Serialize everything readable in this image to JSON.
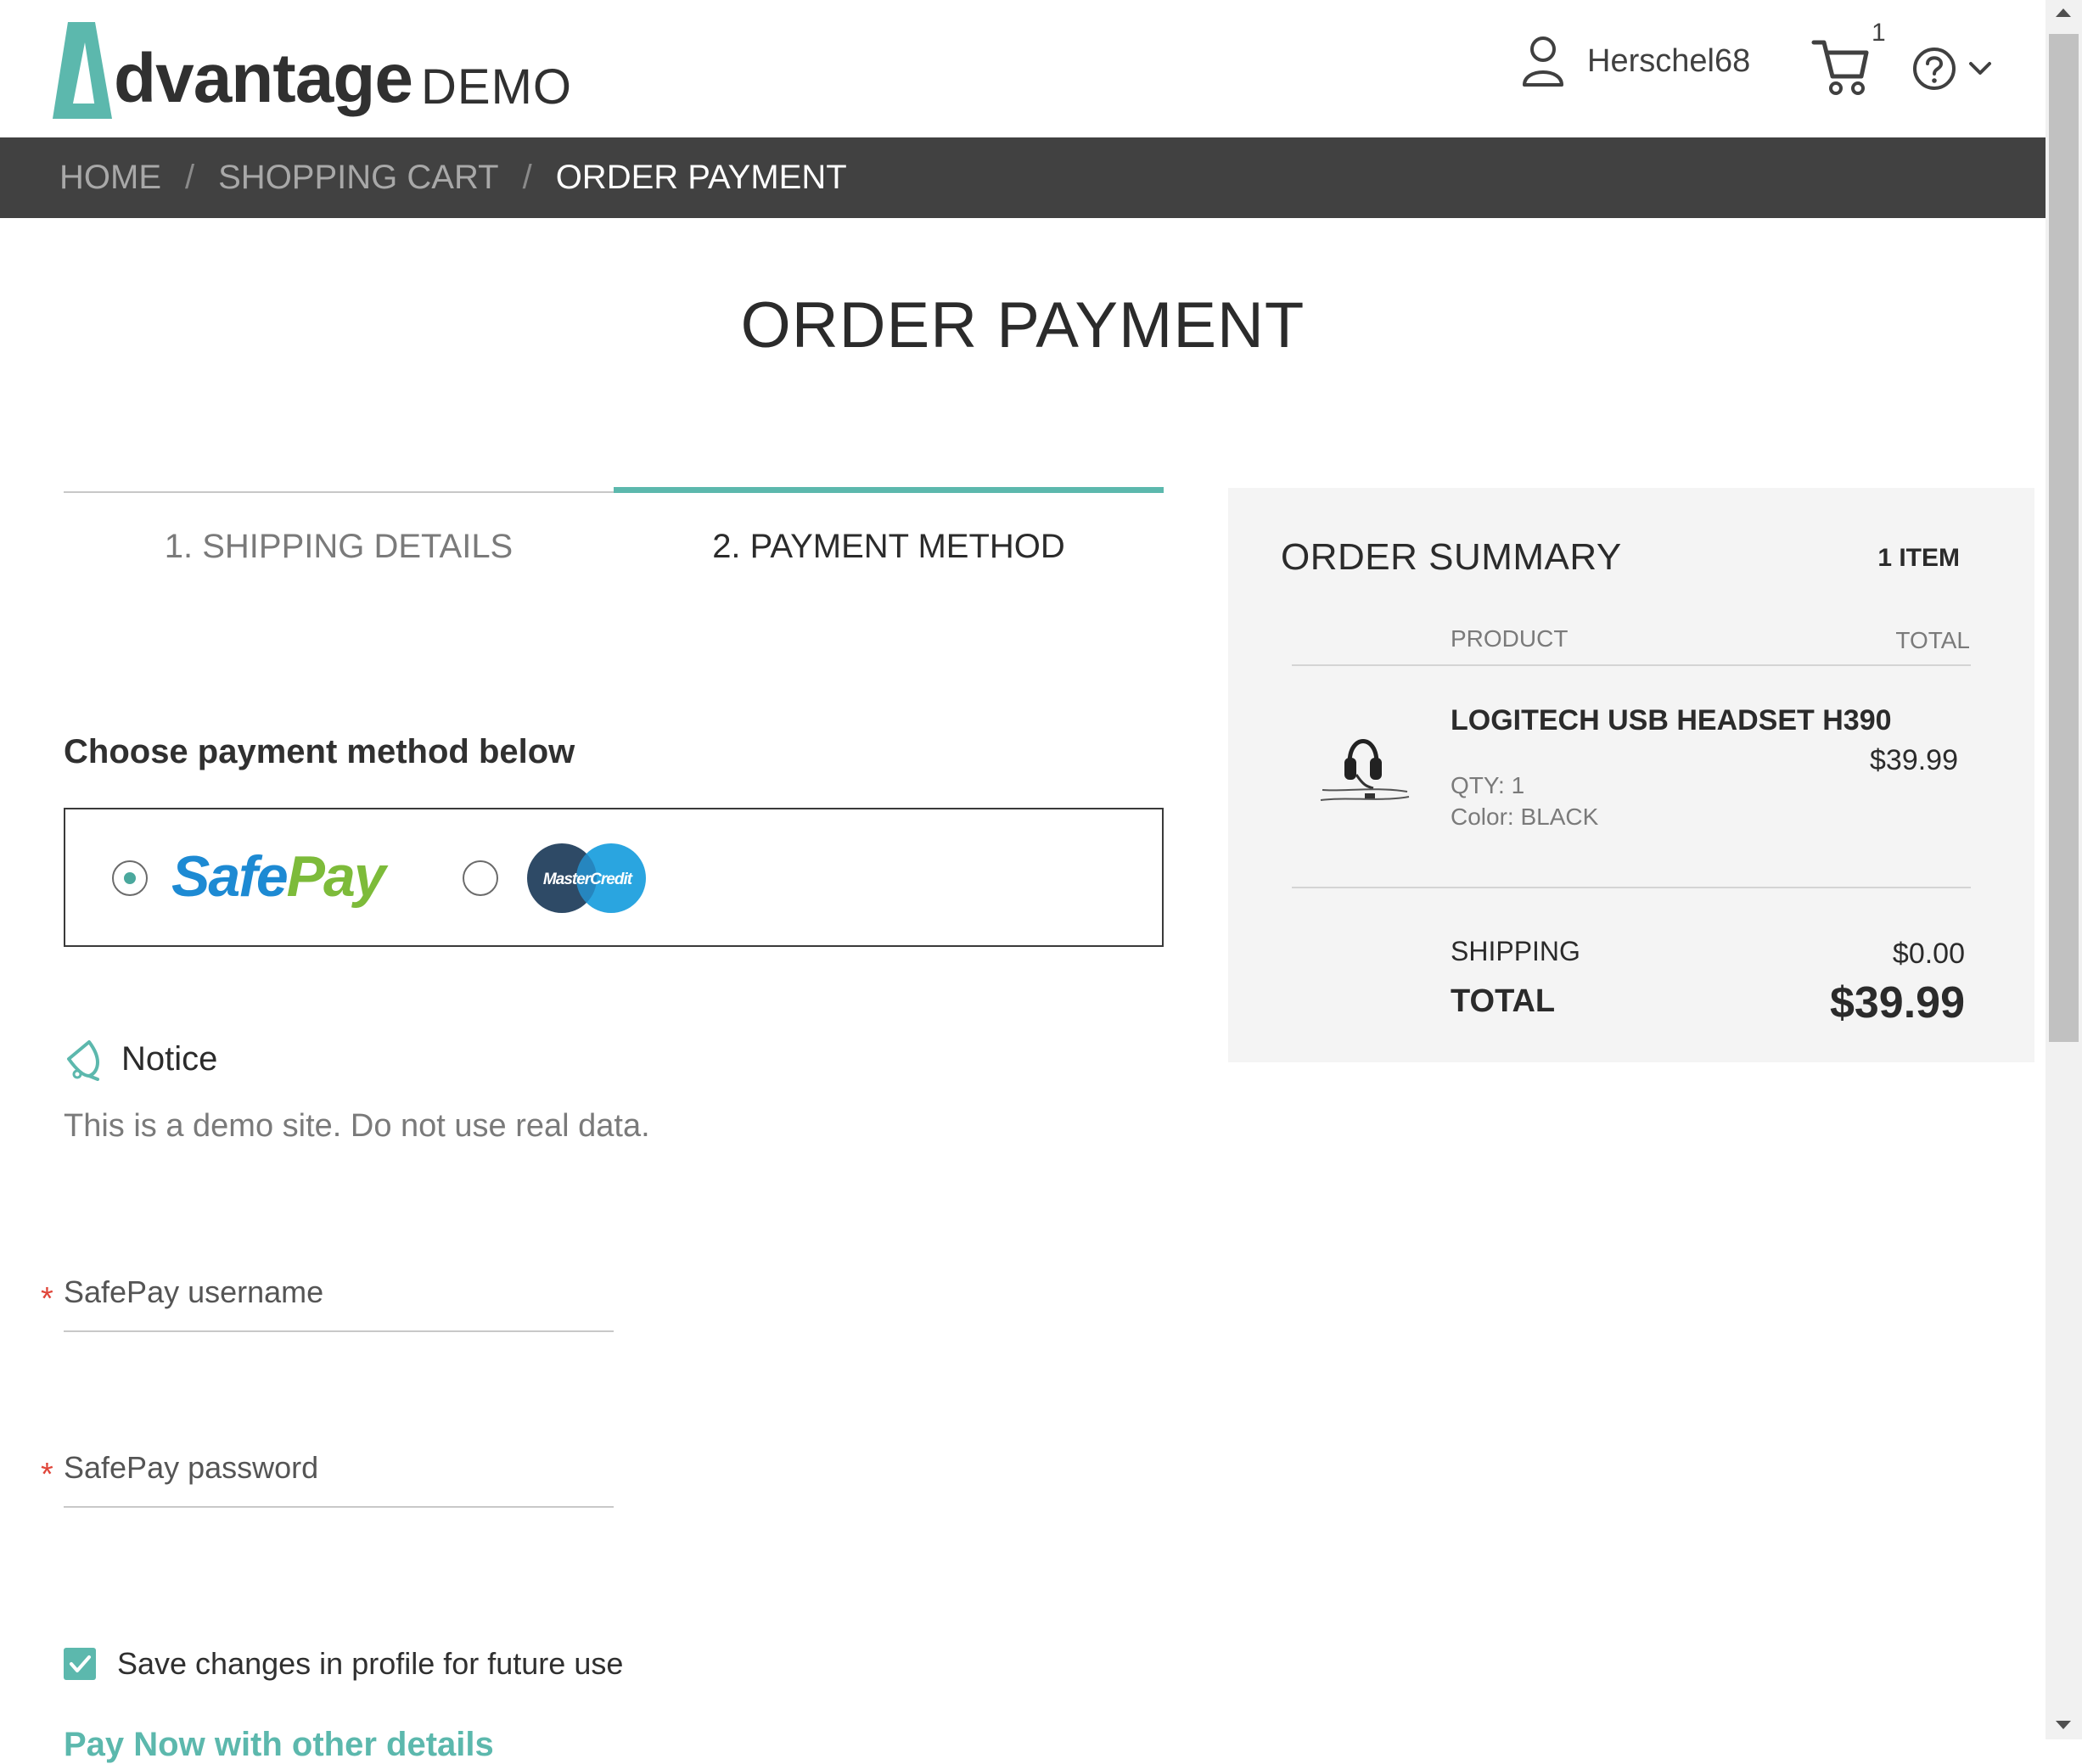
{
  "header": {
    "logo_word": "dvantage",
    "logo_demo": "DEMO",
    "user_name": "Herschel68",
    "cart_count": "1"
  },
  "breadcrumb": {
    "items": [
      "HOME",
      "SHOPPING CART",
      "ORDER PAYMENT"
    ],
    "separator": "/"
  },
  "page_title": "ORDER PAYMENT",
  "steps": {
    "step1": "1. SHIPPING DETAILS",
    "step2": "2. PAYMENT METHOD"
  },
  "payment": {
    "heading": "Choose payment method below",
    "options": [
      {
        "name": "SafePay",
        "selected": true
      },
      {
        "name": "MasterCredit",
        "selected": false
      }
    ],
    "safepay_safe": "Safe",
    "safepay_pay": "Pay",
    "mastercredit_label": "MasterCredit"
  },
  "notice": {
    "title": "Notice",
    "text": "This is a demo site. Do not use real data."
  },
  "form": {
    "username_placeholder": "SafePay username",
    "password_placeholder": "SafePay password",
    "required_mark": "*",
    "save_label": "Save changes in profile for future use",
    "cut_link": "Pay Now with other details"
  },
  "summary": {
    "title": "ORDER SUMMARY",
    "items_count": "1 ITEM",
    "col_product": "PRODUCT",
    "col_total": "TOTAL",
    "product": {
      "name": "LOGITECH USB HEADSET H390",
      "qty": "QTY: 1",
      "color": "Color: BLACK",
      "price": "$39.99"
    },
    "shipping_label": "SHIPPING",
    "shipping_value": "$0.00",
    "total_label": "TOTAL",
    "total_value": "$39.99"
  },
  "colors": {
    "accent": "#5cb8ad",
    "header_bar": "#414141",
    "safepay_blue": "#1d8ad3",
    "safepay_green": "#7dbb3a"
  },
  "icons": [
    "user-icon",
    "cart-icon",
    "help-icon",
    "chevron-down-icon",
    "bell-icon",
    "check-icon"
  ]
}
